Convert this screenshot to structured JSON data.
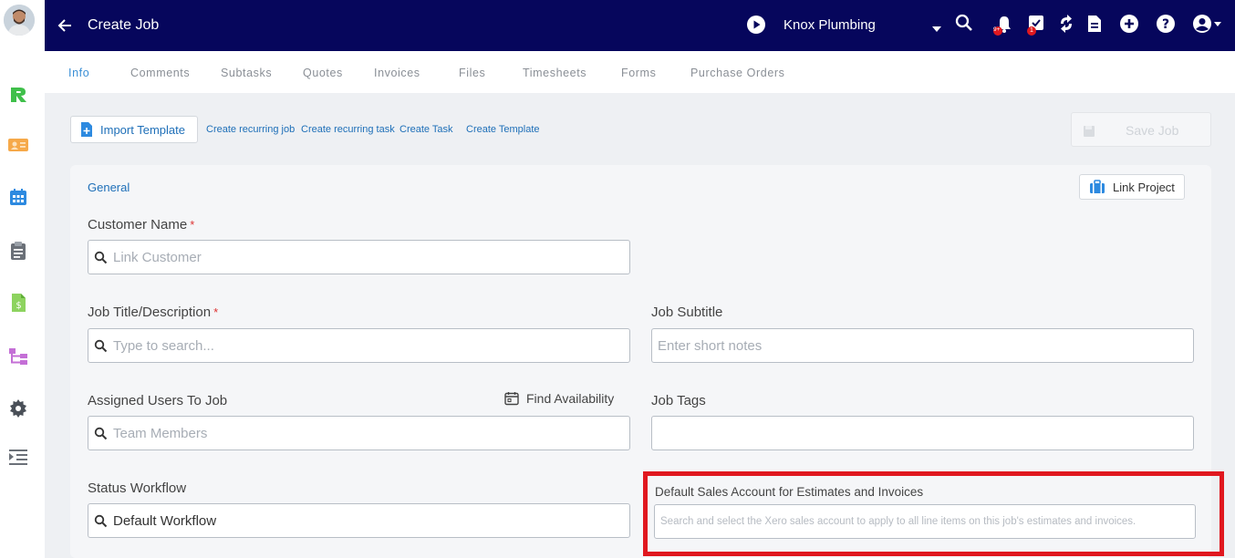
{
  "header": {
    "title": "Create Job",
    "company": "Knox Plumbing",
    "notification_badge": "9+",
    "tasks_badge": "1"
  },
  "tabs": [
    {
      "label": "Info",
      "active": true
    },
    {
      "label": "Comments"
    },
    {
      "label": "Subtasks"
    },
    {
      "label": "Quotes"
    },
    {
      "label": "Invoices"
    },
    {
      "label": "Files"
    },
    {
      "label": "Timesheets"
    },
    {
      "label": "Forms"
    },
    {
      "label": "Purchase Orders"
    }
  ],
  "actions": {
    "import_template": "Import Template",
    "create_recurring_job": "Create recurring job",
    "create_recurring_task": "Create recurring task",
    "create_task": "Create Task",
    "create_template": "Create Template",
    "save_job": "Save Job"
  },
  "general": {
    "section_title": "General",
    "link_project": "Link Project",
    "customer_name": {
      "label": "Customer Name",
      "required": "*",
      "placeholder": "Link Customer"
    },
    "job_title": {
      "label": "Job Title/Description",
      "required": "*",
      "placeholder": "Type to search..."
    },
    "job_subtitle": {
      "label": "Job Subtitle",
      "placeholder": "Enter short notes"
    },
    "assigned_users": {
      "label": "Assigned Users To Job",
      "placeholder": "Team Members",
      "find_availability": "Find Availability"
    },
    "job_tags": {
      "label": "Job Tags"
    },
    "status_workflow": {
      "label": "Status Workflow",
      "value": "Default Workflow"
    },
    "default_sales_account": {
      "label": "Default Sales Account for Estimates and Invoices",
      "placeholder": "Search and select the Xero sales account to apply to all line items on this job's estimates and invoices."
    }
  },
  "colors": {
    "topbar": "#06065c",
    "accent": "#1e6fb8",
    "highlight": "#e0181f"
  }
}
